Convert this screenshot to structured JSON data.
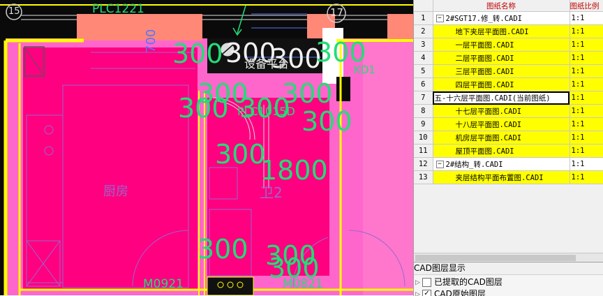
{
  "cad": {
    "grid_left": "15",
    "grid_right": "17",
    "plc_top": "PLC1221",
    "dim_700": "700",
    "equip_label": "设备平台",
    "kd1": "KD1",
    "plc_mid": "PLC1015D",
    "dim_1800": "1800",
    "kitchen": "厨房",
    "bathroom": "卫2",
    "door_left": "M0921",
    "door_right": "M0821",
    "dim_300": "300"
  },
  "sheet_panel": {
    "headers": {
      "col_name": "图纸名称",
      "col_scale": "图纸比例"
    },
    "rows": [
      {
        "no": "1",
        "name": "2#SGT17.修_转.CADI",
        "scale": "1:1",
        "group": true,
        "current": false
      },
      {
        "no": "2",
        "name": "地下夹层平面图.CADI",
        "scale": "1:1",
        "group": false,
        "current": false
      },
      {
        "no": "3",
        "name": "一层平面图.CADI",
        "scale": "1:1",
        "group": false,
        "current": false
      },
      {
        "no": "4",
        "name": "二层平面图.CADI",
        "scale": "1:1",
        "group": false,
        "current": false
      },
      {
        "no": "5",
        "name": "三层平面图.CADI",
        "scale": "1:1",
        "group": false,
        "current": false
      },
      {
        "no": "6",
        "name": "四层平面图.CADI",
        "scale": "1:1",
        "group": false,
        "current": false
      },
      {
        "no": "7",
        "name": "五-十六层平面图.CADI(当前图纸)",
        "scale": "1:1",
        "group": false,
        "current": true
      },
      {
        "no": "8",
        "name": "十七层平面图.CADI",
        "scale": "1:1",
        "group": false,
        "current": false
      },
      {
        "no": "9",
        "name": "十八层平面图.CADI",
        "scale": "1:1",
        "group": false,
        "current": false
      },
      {
        "no": "10",
        "name": "机房层平面图.CADI",
        "scale": "1:1",
        "group": false,
        "current": false
      },
      {
        "no": "11",
        "name": "屋顶平面图.CADI",
        "scale": "1:1",
        "group": false,
        "current": false
      },
      {
        "no": "12",
        "name": "2#结构_转.CADI",
        "scale": "1:1",
        "group": true,
        "current": false
      },
      {
        "no": "13",
        "name": "夹层结构平面布置图.CADI",
        "scale": "1:1",
        "group": false,
        "current": false
      }
    ]
  },
  "layer_panel": {
    "title": "CAD图层显示",
    "items": [
      {
        "label": "已提取的CAD图层",
        "checked": false
      },
      {
        "label": "CAD原始图层",
        "checked": true
      }
    ]
  },
  "colors": {
    "room_fill": "#ff0080",
    "wall_fill": "#ff66cc",
    "dim_text": "#22dd77",
    "highlight": "#ffff00",
    "cad_bg": "#0a0a0a"
  }
}
